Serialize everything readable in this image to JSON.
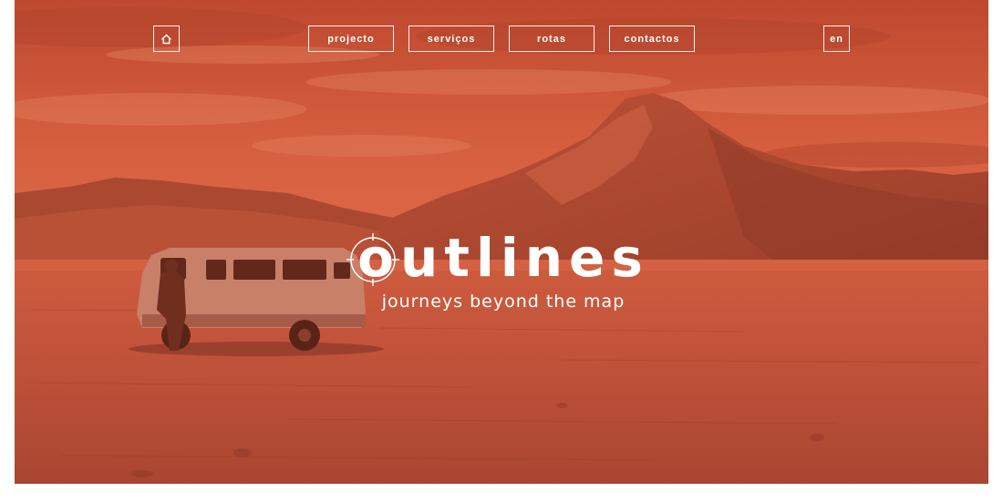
{
  "nav": {
    "home_icon": "home-icon",
    "menu": [
      {
        "label": "projecto"
      },
      {
        "label": "serviços"
      },
      {
        "label": "rotas"
      },
      {
        "label": "contactos"
      }
    ],
    "language": "en"
  },
  "hero": {
    "logo_text": "outlines",
    "tagline": "journeys beyond the map",
    "tint_color": "#c9573a"
  }
}
